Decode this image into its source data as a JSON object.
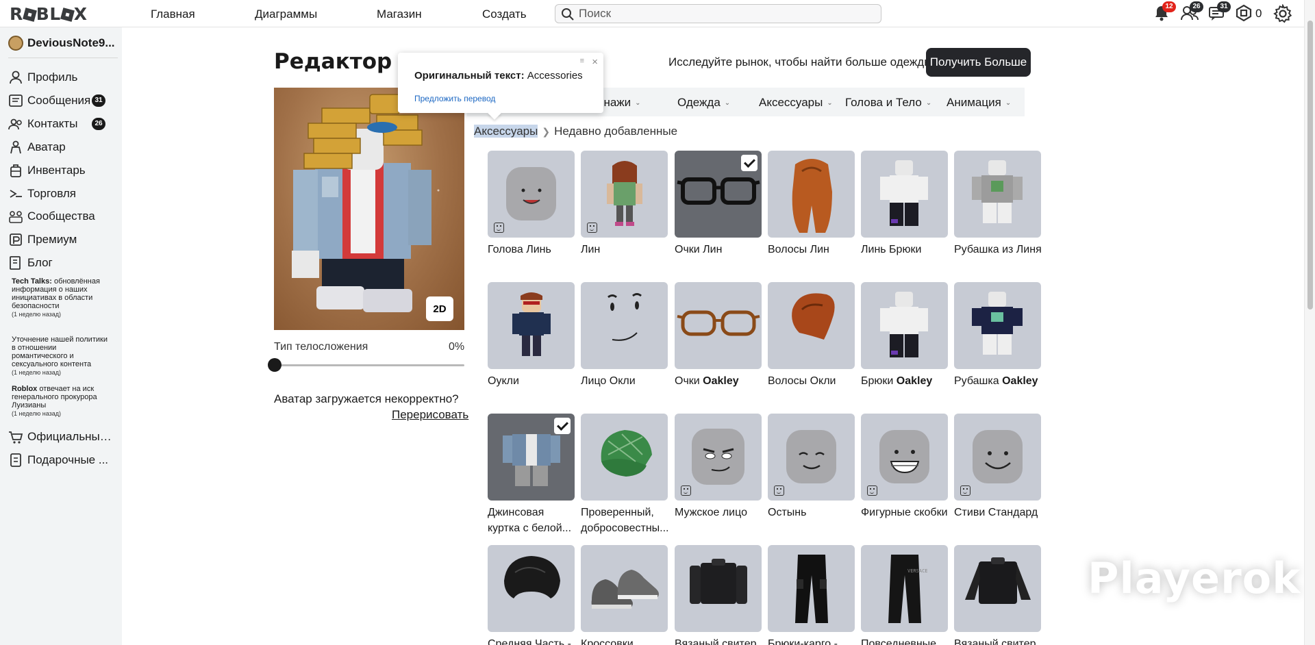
{
  "header": {
    "logo": "ROBLOX",
    "nav": [
      "Главная",
      "Диаграммы",
      "Магазин",
      "Создать"
    ],
    "search_placeholder": "Поиск",
    "notifications_badge": "12",
    "friends_badge": "26",
    "messages_badge": "31",
    "robux": "0"
  },
  "sidebar": {
    "username": "DeviousNote9...",
    "items": [
      {
        "label": "Профиль",
        "icon": "user-icon"
      },
      {
        "label": "Сообщения",
        "icon": "messages-icon",
        "badge": "31"
      },
      {
        "label": "Контакты",
        "icon": "contacts-icon",
        "badge": "26"
      },
      {
        "label": "Аватар",
        "icon": "avatar-icon"
      },
      {
        "label": "Инвентарь",
        "icon": "inventory-icon"
      },
      {
        "label": "Торговля",
        "icon": "trade-icon"
      },
      {
        "label": "Сообщества",
        "icon": "communities-icon"
      },
      {
        "label": "Премиум",
        "icon": "premium-icon"
      },
      {
        "label": "Блог",
        "icon": "blog-icon"
      }
    ],
    "blog": [
      {
        "title": "Tech Talks:",
        "text": "обновлённая информация о наших инициативах в области безопасности",
        "ago": "(1 неделю назад)"
      },
      {
        "title": "",
        "text": "Уточнение нашей политики в отношении романтического и сексуального контента",
        "ago": "(1 неделю назад)"
      },
      {
        "title": "Roblox",
        "text": "отвечает на иск генерального прокурора Луизианы",
        "ago": "(1 неделю назад)"
      }
    ],
    "bottom_items": [
      {
        "label": "Официальный...",
        "icon": "store-icon"
      },
      {
        "label": "Подарочные ...",
        "icon": "gift-card-icon"
      }
    ]
  },
  "main": {
    "title": "Редактор А",
    "explore_text": "Исследуйте рынок, чтобы найти больше одежды!",
    "get_more": "Получить Больше",
    "btn_2d": "2D",
    "body_type_label": "Тип телосложения",
    "body_type_value": "0%",
    "body_type_level": 0,
    "loading_text": "Аватар загружается некорректно?",
    "redraw": "Перерисовать",
    "tabs": [
      "онажи",
      "Одежда",
      "Аксессуары",
      "Голова и Тело",
      "Анимация"
    ],
    "breadcrumb": [
      "Аксессуары",
      "Недавно добавленные"
    ]
  },
  "popup": {
    "original_label": "Оригинальный текст:",
    "original_value": "Accessories",
    "suggest": "Предложить перевод",
    "close": "×",
    "menu": "≡"
  },
  "grid": [
    {
      "name": "Голова Линь",
      "type": "head-smile",
      "emote": true
    },
    {
      "name": "Лин",
      "type": "girl",
      "emote": true
    },
    {
      "name": "Очки Лин",
      "type": "glasses-black",
      "selected": true
    },
    {
      "name": "Волосы Лин",
      "type": "hair-long"
    },
    {
      "name": "Линь Брюки",
      "type": "pants-dummy"
    },
    {
      "name": "Рубашка из Линя",
      "type": "shirt-grey"
    },
    {
      "name": "Оукли",
      "type": "boy"
    },
    {
      "name": "Лицо Окли",
      "type": "face"
    },
    {
      "name": "Очки",
      "bold": "Oakley",
      "type": "glasses-brown"
    },
    {
      "name": "Волосы Окли",
      "type": "hair-short"
    },
    {
      "name": "Брюки",
      "bold": "Oakley",
      "type": "pants-dummy"
    },
    {
      "name": "Рубашка",
      "bold": "Oakley",
      "type": "shirt-navy"
    },
    {
      "name": "Джинсовая куртка с белой...",
      "type": "jacket",
      "selected": true
    },
    {
      "name": "Проверенный, добросовестны...",
      "type": "cap"
    },
    {
      "name": "Мужское лицо",
      "type": "head-man",
      "emote": true
    },
    {
      "name": "Остынь",
      "type": "head-chill",
      "emote": true
    },
    {
      "name": "Фигурные скобки",
      "type": "head-braces",
      "emote": true
    },
    {
      "name": "Стиви Стандард",
      "type": "head-smile2",
      "emote": true
    },
    {
      "name": "Средняя Часть -",
      "type": "hair-black"
    },
    {
      "name": "Кроссовки",
      "type": "sneakers"
    },
    {
      "name": "Вязаный свитер",
      "type": "sweater"
    },
    {
      "name": "Брюки-карго -",
      "type": "cargo"
    },
    {
      "name": "Повседневные",
      "type": "joggers"
    },
    {
      "name": "Вязаный свитер",
      "type": "sweater2"
    }
  ],
  "watermark": "Playerok"
}
